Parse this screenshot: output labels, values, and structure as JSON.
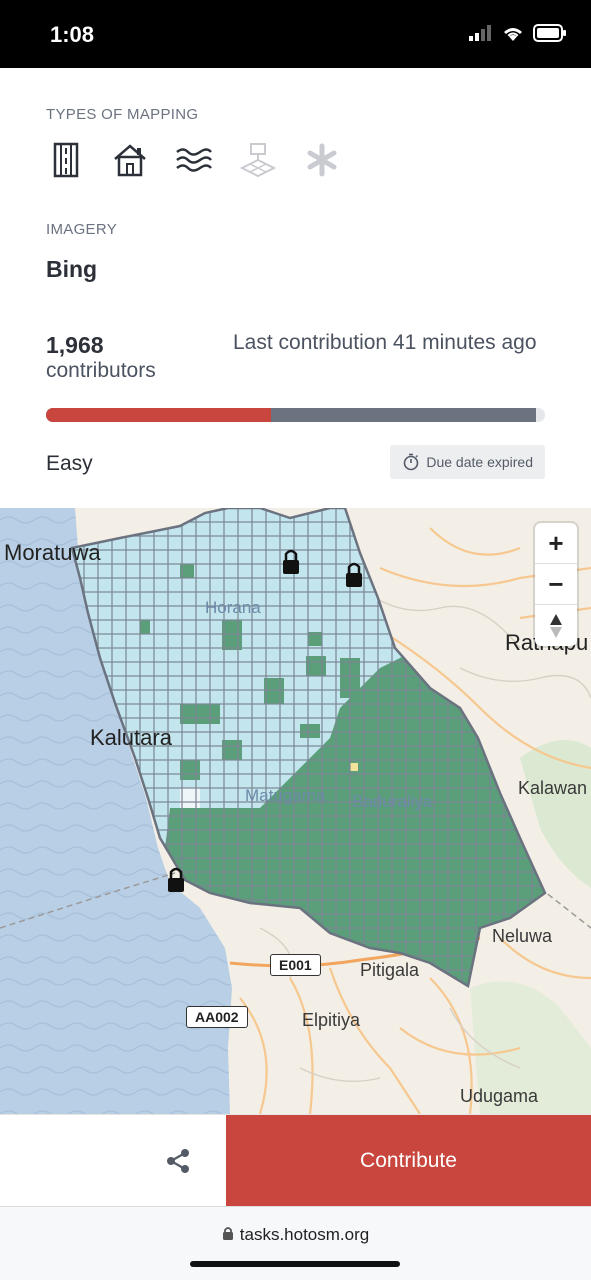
{
  "status": {
    "time": "1:08"
  },
  "types": {
    "label": "TYPES OF MAPPING",
    "icons": [
      "roads-icon",
      "buildings-icon",
      "waterways-icon",
      "landuse-icon",
      "other-icon"
    ]
  },
  "imagery": {
    "label": "IMAGERY",
    "value": "Bing"
  },
  "stats": {
    "contributors_count": "1,968",
    "contributors_label": "contributors",
    "last_contribution": "Last contribution 41 minutes ago",
    "percent_mapped": 45,
    "percent_validated": 100
  },
  "difficulty": "Easy",
  "due_badge": {
    "text": "Due date expired",
    "icon": "stopwatch-icon"
  },
  "map": {
    "places": [
      "Moratuwa",
      "Horana",
      "Ratnapu",
      "Kalutara",
      "Kalawan",
      "Matugama",
      "Baduraliya",
      "Neluwa",
      "Pitigala",
      "Elpitiya",
      "Udugama"
    ],
    "roads": [
      "E001",
      "AA002"
    ],
    "zoom_in": "+",
    "zoom_out": "−",
    "reset": "▲"
  },
  "actions": {
    "share_icon": "share-icon",
    "contribute": "Contribute"
  },
  "browser": {
    "url": "tasks.hotosm.org"
  },
  "colors": {
    "primary": "#c8463d",
    "validated": "#6b7280",
    "mapped_fill": "#5a9e7a",
    "todo_fill": "#c3e6ee",
    "water": "#b9cfe5"
  }
}
